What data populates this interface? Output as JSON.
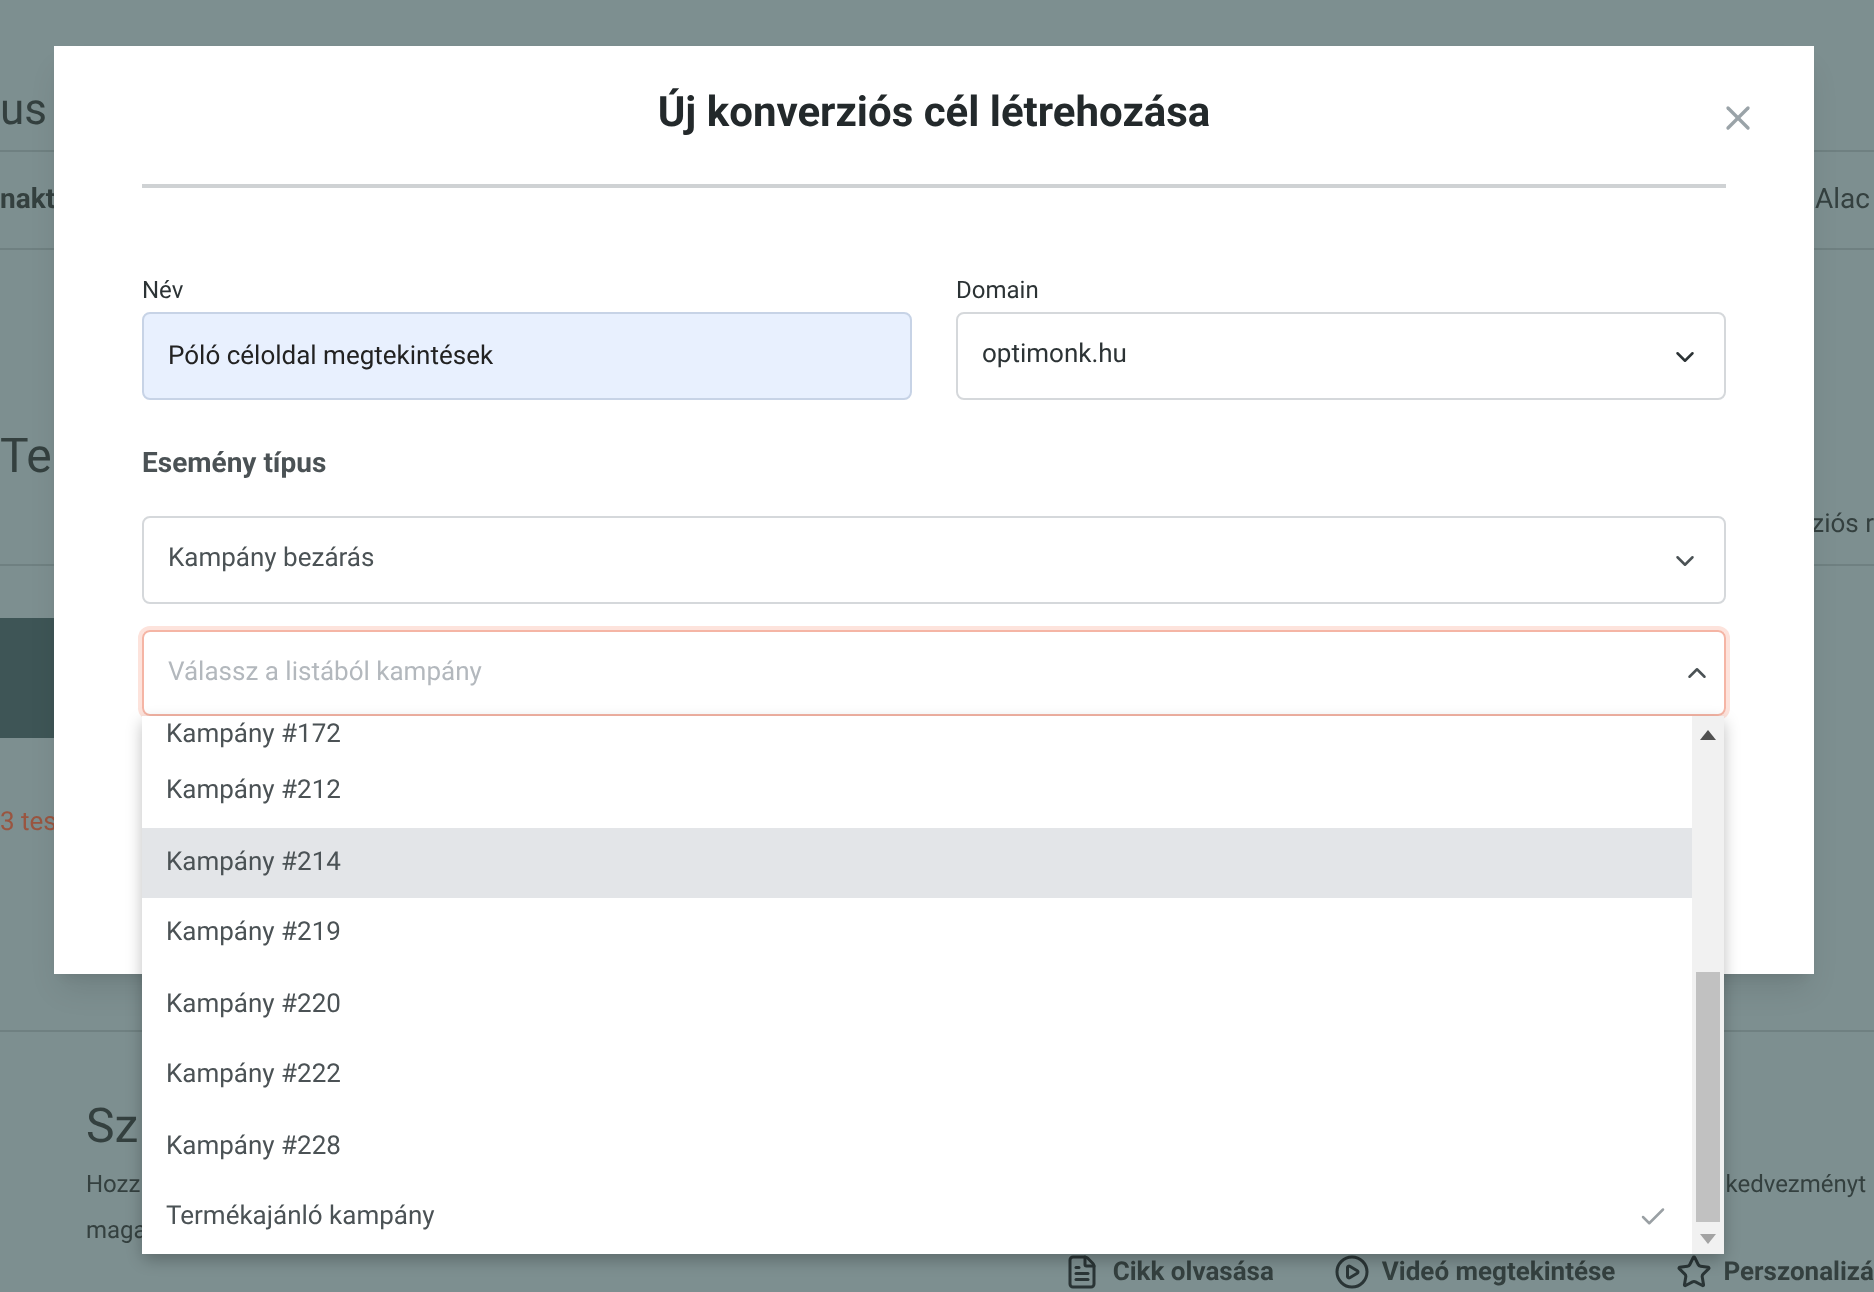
{
  "background": {
    "heading": "us",
    "tab_left": "nakt",
    "tab_right": "Alac",
    "section_title": "Te",
    "column_right": "ziós r",
    "test_count": "3 tes",
    "card_title": "Sz",
    "card_text_left_1": "Hozz",
    "card_text_right": "kedvezményt",
    "card_text_left_2": "maga",
    "actions": [
      {
        "kind": "article",
        "label": "Cikk olvasása"
      },
      {
        "kind": "video",
        "label": "Videó megtekintése"
      },
      {
        "kind": "star",
        "label": "Perszonalizá"
      }
    ]
  },
  "dialog": {
    "title": "Új konverziós cél létrehozása",
    "name_field": {
      "label": "Név",
      "value": "Póló céloldal megtekintések"
    },
    "domain_field": {
      "label": "Domain",
      "value": "optimonk.hu"
    },
    "event_type": {
      "label": "Esemény típus",
      "value": "Kampány bezárás"
    },
    "campaign_field": {
      "placeholder": "Válassz a listából kampány",
      "expanded": true
    },
    "options": [
      {
        "label": "Kampány #172",
        "highlighted": false,
        "selected": false
      },
      {
        "label": "Kampány #212",
        "highlighted": false,
        "selected": false
      },
      {
        "label": "Kampány #214",
        "highlighted": true,
        "selected": false
      },
      {
        "label": "Kampány #219",
        "highlighted": false,
        "selected": false
      },
      {
        "label": "Kampány #220",
        "highlighted": false,
        "selected": false
      },
      {
        "label": "Kampány #222",
        "highlighted": false,
        "selected": false
      },
      {
        "label": "Kampány #228",
        "highlighted": false,
        "selected": false
      },
      {
        "label": "Termékajánló kampány",
        "highlighted": false,
        "selected": true
      }
    ]
  }
}
